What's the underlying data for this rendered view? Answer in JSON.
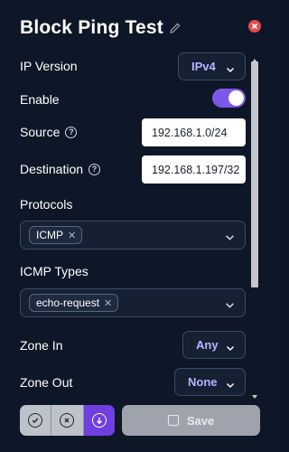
{
  "title": "Block Ping Test",
  "fields": {
    "ip_version": {
      "label": "IP Version",
      "value": "IPv4"
    },
    "enable": {
      "label": "Enable",
      "on": true
    },
    "source": {
      "label": "Source",
      "value": "192.168.1.0/24"
    },
    "destination": {
      "label": "Destination",
      "value": "192.168.1.197/32"
    },
    "protocols": {
      "label": "Protocols",
      "chips": [
        "ICMP"
      ]
    },
    "icmp_types": {
      "label": "ICMP Types",
      "chips": [
        "echo-request"
      ]
    },
    "zone_in": {
      "label": "Zone In",
      "value": "Any"
    },
    "zone_out": {
      "label": "Zone Out",
      "value": "None"
    }
  },
  "footer": {
    "save_label": "Save"
  },
  "colors": {
    "background": "#0e1727",
    "accent": "#7c57e8",
    "dropdown_text": "#b7b3ff",
    "close": "#e44c4c"
  }
}
